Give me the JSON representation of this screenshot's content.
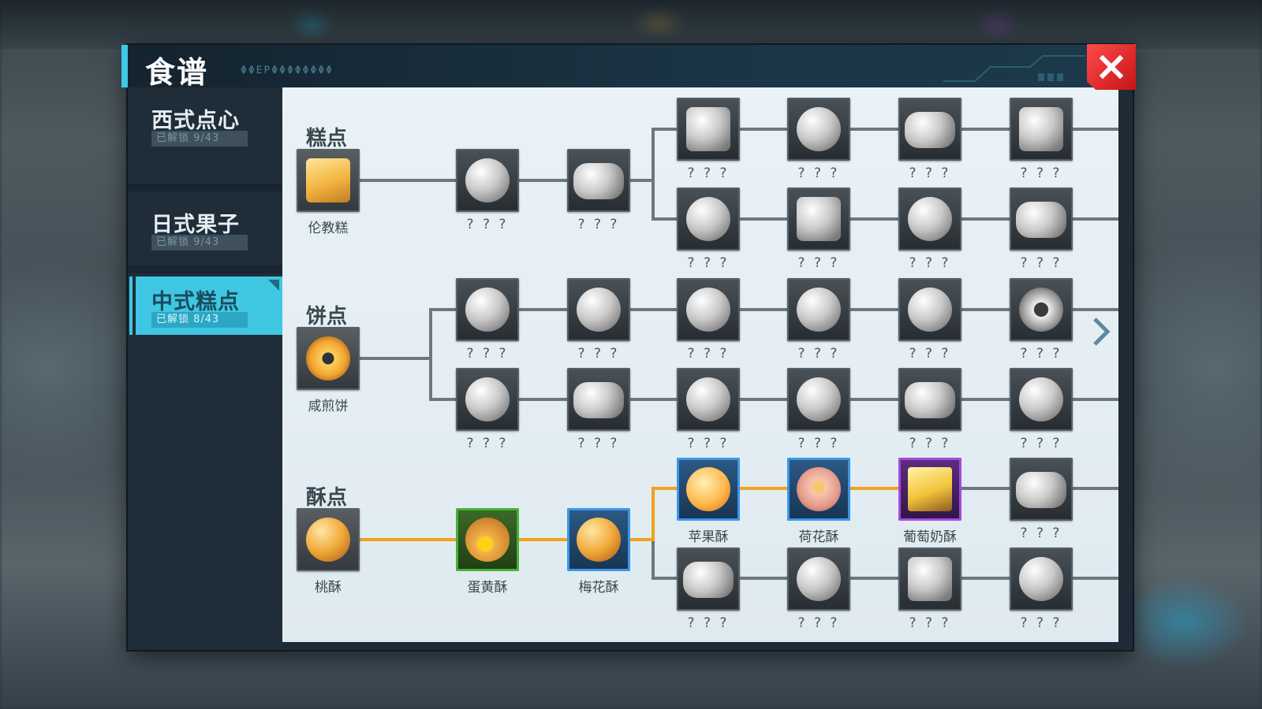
{
  "window": {
    "title": "食谱",
    "subtitle": "ΦΦΕΡΦΦΦΦΦΦΦΦ"
  },
  "sidebar": {
    "tabs": [
      {
        "label": "西式点心",
        "count": "已解锁 9/43",
        "active": false
      },
      {
        "label": "日式果子",
        "count": "已解锁 9/43",
        "active": false
      },
      {
        "label": "中式糕点",
        "count": "已解锁 8/43",
        "active": true
      }
    ]
  },
  "sections": {
    "cake": {
      "title": "糕点",
      "root": {
        "label": "伦教糕",
        "icon": "sponge-cake-icon",
        "unlocked": true
      },
      "chain": [
        {
          "label": "? ? ?",
          "icon": "round-cake-icon"
        },
        {
          "label": "? ? ?",
          "icon": "leaf-cake-icon"
        }
      ],
      "rows": [
        [
          {
            "label": "? ? ?",
            "icon": "square-cake-icon"
          },
          {
            "label": "? ? ?",
            "icon": "fan-pastry-icon"
          },
          {
            "label": "? ? ?",
            "icon": "boxed-cake-icon"
          },
          {
            "label": "? ? ?",
            "icon": "bun-cake-icon"
          }
        ],
        [
          {
            "label": "? ? ?",
            "icon": "sesame-cake-icon"
          },
          {
            "label": "? ? ?",
            "icon": "layer-cake-icon"
          },
          {
            "label": "? ? ?",
            "icon": "bowl-cake-icon"
          },
          {
            "label": "? ? ?",
            "icon": "stacked-cake-icon"
          }
        ]
      ]
    },
    "biscuit": {
      "title": "饼点",
      "root": {
        "label": "咸煎饼",
        "icon": "fried-donut-icon",
        "unlocked": true
      },
      "rows": [
        [
          {
            "label": "? ? ?",
            "icon": "mooncake-icon"
          },
          {
            "label": "? ? ?",
            "icon": "flower-biscuit-icon"
          },
          {
            "label": "? ? ?",
            "icon": "round-biscuit-icon"
          },
          {
            "label": "? ? ?",
            "icon": "roll-biscuit-icon"
          },
          {
            "label": "? ? ?",
            "icon": "filled-biscuit-icon"
          },
          {
            "label": "? ? ?",
            "icon": "ring-biscuit-icon"
          }
        ],
        [
          {
            "label": "? ? ?",
            "icon": "stamped-biscuit-icon"
          },
          {
            "label": "? ? ?",
            "icon": "crust-biscuit-icon"
          },
          {
            "label": "? ? ?",
            "icon": "bean-biscuit-icon"
          },
          {
            "label": "? ? ?",
            "icon": "flower-cake-icon"
          },
          {
            "label": "? ? ?",
            "icon": "oval-biscuit-icon"
          },
          {
            "label": "? ? ?",
            "icon": "swirl-biscuit-icon"
          }
        ]
      ]
    },
    "pastry": {
      "title": "酥点",
      "root": {
        "label": "桃酥",
        "icon": "walnut-cookie-icon",
        "unlocked": true
      },
      "chain": [
        {
          "label": "蛋黄酥",
          "icon": "egg-yolk-pastry-icon",
          "quality": "green"
        },
        {
          "label": "梅花酥",
          "icon": "plum-blossom-pastry-icon",
          "quality": "blue"
        }
      ],
      "rows": [
        [
          {
            "label": "苹果酥",
            "icon": "apple-pastry-icon",
            "quality": "blue"
          },
          {
            "label": "荷花酥",
            "icon": "lotus-pastry-icon",
            "quality": "blue"
          },
          {
            "label": "葡萄奶酥",
            "icon": "grape-milk-pastry-icon",
            "quality": "purple"
          },
          {
            "label": "? ? ?",
            "icon": "plate-pastry-icon"
          }
        ],
        [
          {
            "label": "? ? ?",
            "icon": "twisted-pastry-icon"
          },
          {
            "label": "? ? ?",
            "icon": "round-pastry-icon"
          },
          {
            "label": "? ? ?",
            "icon": "box-pastry-icon"
          },
          {
            "label": "? ? ?",
            "icon": "chunk-pastry-icon"
          }
        ]
      ]
    }
  },
  "colors": {
    "accent": "#3fc7e3",
    "unlocked_line": "#f0a31e",
    "locked_line": "#6f777c",
    "close": "#e02424"
  }
}
